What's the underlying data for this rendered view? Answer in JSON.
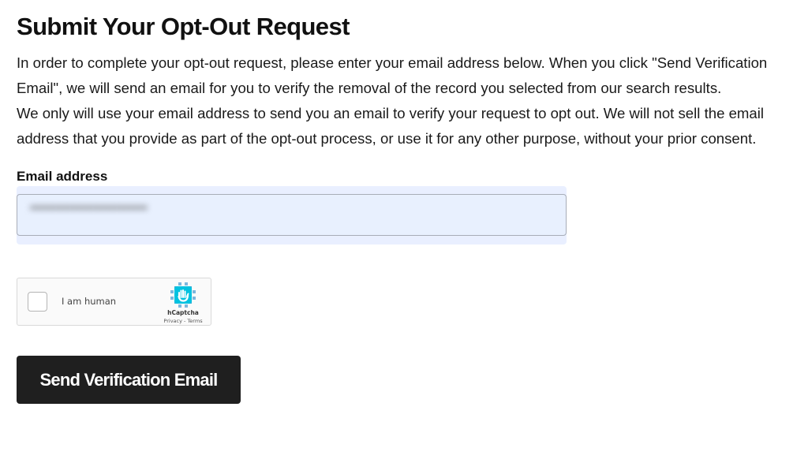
{
  "page": {
    "title": "Submit Your Opt-Out Request",
    "intro_paragraph_1": "In order to complete your opt-out request, please enter your email address below. When you click \"Send Verification Email\", we will send an email for you to verify the removal of the record you selected from our search results.",
    "intro_paragraph_2": "We only will use your email address to send you an email to verify your request to opt out. We will not sell the email address that you provide as part of the opt-out process, or use it for any other purpose, without your prior consent."
  },
  "form": {
    "email_label": "Email address",
    "email_value": "•••••••••••••••••••••••••"
  },
  "captcha": {
    "label": "I am human",
    "brand": "hCaptcha",
    "links": "Privacy - Terms",
    "logo_color": "#00c2e0"
  },
  "submit": {
    "label": "Send Verification Email",
    "bg_color": "#1f1f1f"
  }
}
